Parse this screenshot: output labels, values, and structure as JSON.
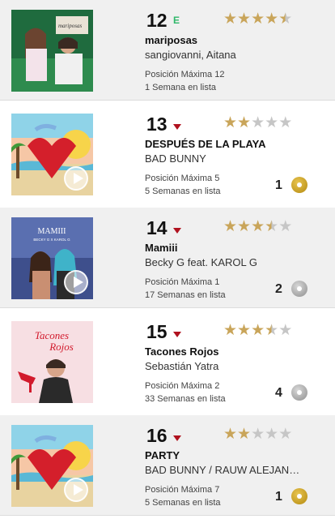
{
  "entries": [
    {
      "position": "12",
      "trend": "new",
      "trend_label": "E",
      "stars": 4.5,
      "title": "mariposas",
      "artist": "sangiovanni, Aitana",
      "peak": "Posición Máxima 12",
      "weeks": "1 Semana en lista",
      "certification_count": "",
      "certification_type": "",
      "cover_icon": "cover-mariposas",
      "play_button": false
    },
    {
      "position": "13",
      "trend": "down",
      "trend_label": "",
      "stars": 2,
      "title": "DESPUÉS DE LA PLAYA",
      "artist": "BAD BUNNY",
      "peak": "Posición Máxima 5",
      "weeks": "5 Semanas en lista",
      "certification_count": "1",
      "certification_type": "gold",
      "cover_icon": "cover-un-verano-sin-ti",
      "play_button": true
    },
    {
      "position": "14",
      "trend": "down",
      "trend_label": "",
      "stars": 3.5,
      "title": "Mamiii",
      "artist": "Becky G feat. KAROL G",
      "peak": "Posición Máxima 1",
      "weeks": "17 Semanas en lista",
      "certification_count": "2",
      "certification_type": "platinum",
      "cover_icon": "cover-mamiii",
      "play_button": true
    },
    {
      "position": "15",
      "trend": "down",
      "trend_label": "",
      "stars": 3.5,
      "title": "Tacones Rojos",
      "artist": "Sebastián Yatra",
      "peak": "Posición Máxima 2",
      "weeks": "33 Semanas en lista",
      "certification_count": "4",
      "certification_type": "platinum",
      "cover_icon": "cover-tacones-rojos",
      "play_button": false
    },
    {
      "position": "16",
      "trend": "down",
      "trend_label": "",
      "stars": 2,
      "title": "PARTY",
      "artist": "BAD BUNNY / RAUW ALEJANDRO",
      "peak": "Posición Máxima 7",
      "weeks": "5 Semanas en lista",
      "certification_count": "1",
      "certification_type": "gold",
      "cover_icon": "cover-un-verano-sin-ti",
      "play_button": true
    }
  ],
  "cover_texts": {
    "mariposas": "mariposas",
    "mamiii_title": "MAMIII",
    "mamiii_sub": "BECKY G X KAROL G",
    "tacones_1": "Tacones",
    "tacones_2": "Rojos"
  },
  "colors": {
    "star_on": "#c9a55a",
    "star_off": "#c6c6c6",
    "trend_down": "#b0121f",
    "trend_new": "#2fb86a",
    "row_shade": "#f0f0f0"
  }
}
